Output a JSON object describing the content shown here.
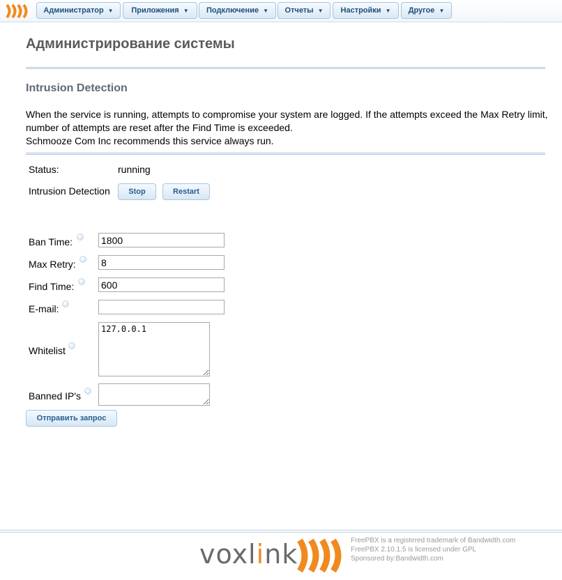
{
  "nav": {
    "menus": [
      {
        "label": "Администратор"
      },
      {
        "label": "Приложения"
      },
      {
        "label": "Подключение"
      },
      {
        "label": "Отчеты"
      },
      {
        "label": "Настройки"
      },
      {
        "label": "Другое"
      }
    ]
  },
  "page": {
    "title": "Администрирование системы",
    "section_title": "Intrusion Detection",
    "description": [
      "When the service is running, attempts to compromise your system are logged. If the attempts exceed the Max Retry limit,",
      "number of attempts are reset after the Find Time is exceeded.",
      "Schmooze Com Inc recommends this service always run."
    ]
  },
  "status": {
    "label": "Status:",
    "value": "running"
  },
  "service": {
    "label": "Intrusion Detection",
    "stop_label": "Stop",
    "restart_label": "Restart"
  },
  "form": {
    "ban_time_label": "Ban Time:",
    "ban_time_value": "1800",
    "max_retry_label": "Max Retry:",
    "max_retry_value": "8",
    "find_time_label": "Find Time:",
    "find_time_value": "600",
    "email_label": "E-mail:",
    "email_value": "",
    "whitelist_label": "Whitelist",
    "whitelist_value": "127.0.0.1",
    "banned_label": "Banned IP's",
    "banned_value": "",
    "submit_label": "Отправить запрос"
  },
  "footer": {
    "brand_prefix": "voxl",
    "brand_accent": "i",
    "brand_suffix": "nk",
    "legal": [
      "FreePBX is a registered trademark of Bandwidth.com",
      "FreePBX 2.10.1.5 is licensed under GPL",
      "Sponsored by:Bandwidth.com"
    ]
  },
  "colors": {
    "accent_orange": "#f08a1e",
    "nav_text": "#1d4f7a",
    "rule_blue": "#a7c4de"
  }
}
